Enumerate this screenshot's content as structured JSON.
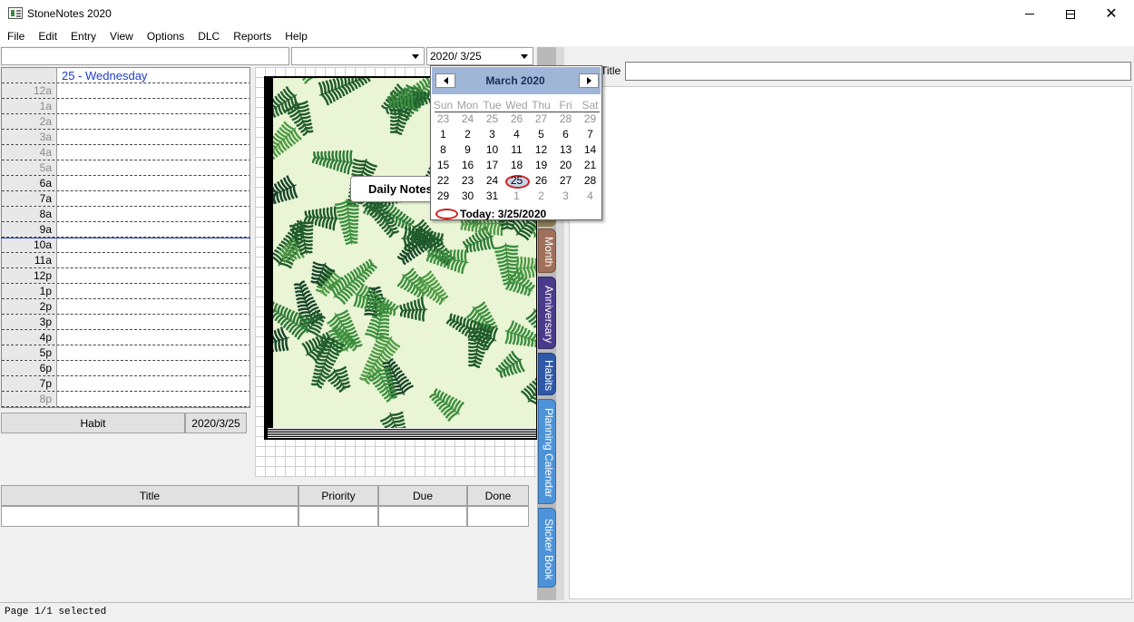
{
  "window": {
    "title": "StoneNotes 2020"
  },
  "menu": [
    "File",
    "Edit",
    "Entry",
    "View",
    "Options",
    "DLC",
    "Reports",
    "Help"
  ],
  "toolbar": {
    "search_value": "",
    "category_value": "",
    "date_value": "2020/  3/25"
  },
  "schedule": {
    "header": "25 - Wednesday",
    "rows": [
      {
        "time": "12a",
        "off": true
      },
      {
        "time": "1a",
        "off": true
      },
      {
        "time": "2a",
        "off": true
      },
      {
        "time": "3a",
        "off": true
      },
      {
        "time": "4a",
        "off": true
      },
      {
        "time": "5a",
        "off": true
      },
      {
        "time": "6a",
        "off": false
      },
      {
        "time": "7a",
        "off": false
      },
      {
        "time": "8a",
        "off": false
      },
      {
        "time": "9a",
        "off": false
      },
      {
        "time": "10a",
        "off": false
      },
      {
        "time": "11a",
        "off": false
      },
      {
        "time": "12p",
        "off": false
      },
      {
        "time": "1p",
        "off": false
      },
      {
        "time": "2p",
        "off": false
      },
      {
        "time": "3p",
        "off": false
      },
      {
        "time": "4p",
        "off": false
      },
      {
        "time": "5p",
        "off": false
      },
      {
        "time": "6p",
        "off": false
      },
      {
        "time": "7p",
        "off": false
      },
      {
        "time": "8p",
        "off": true
      }
    ],
    "current_line_color": "#1e3ccc"
  },
  "habit": {
    "label": "Habit",
    "date": "2020/3/25"
  },
  "tasks": {
    "columns": [
      "Title",
      "Priority",
      "Due",
      "Done"
    ]
  },
  "notebook": {
    "tab_label": "Daily Notes"
  },
  "side_tabs": [
    {
      "label": "Month",
      "color": "#a0705a"
    },
    {
      "label": "Anniversary",
      "color": "#4a3a8a"
    },
    {
      "label": "Habits",
      "color": "#2f58a8"
    },
    {
      "label": "Planning Calendar",
      "color": "#4d93d9"
    },
    {
      "label": "Sticker Book",
      "color": "#4d93d9"
    }
  ],
  "note": {
    "title_label": "Title",
    "title_value": ""
  },
  "status": {
    "text": "Page 1/1 selected"
  },
  "calendar": {
    "month_label": "March 2020",
    "weekdays": [
      "Sun",
      "Mon",
      "Tue",
      "Wed",
      "Thu",
      "Fri",
      "Sat"
    ],
    "weeks": [
      [
        [
          "23",
          1
        ],
        [
          "24",
          1
        ],
        [
          "25",
          1
        ],
        [
          "26",
          1
        ],
        [
          "27",
          1
        ],
        [
          "28",
          1
        ],
        [
          "29",
          1
        ]
      ],
      [
        [
          "1",
          0
        ],
        [
          "2",
          0
        ],
        [
          "3",
          0
        ],
        [
          "4",
          0
        ],
        [
          "5",
          0
        ],
        [
          "6",
          0
        ],
        [
          "7",
          0
        ]
      ],
      [
        [
          "8",
          0
        ],
        [
          "9",
          0
        ],
        [
          "10",
          0
        ],
        [
          "11",
          0
        ],
        [
          "12",
          0
        ],
        [
          "13",
          0
        ],
        [
          "14",
          0
        ]
      ],
      [
        [
          "15",
          0
        ],
        [
          "16",
          0
        ],
        [
          "17",
          0
        ],
        [
          "18",
          0
        ],
        [
          "19",
          0
        ],
        [
          "20",
          0
        ],
        [
          "21",
          0
        ]
      ],
      [
        [
          "22",
          0
        ],
        [
          "23",
          0
        ],
        [
          "24",
          0
        ],
        [
          "25",
          0
        ],
        [
          "26",
          0
        ],
        [
          "27",
          0
        ],
        [
          "28",
          0
        ]
      ],
      [
        [
          "29",
          0
        ],
        [
          "30",
          0
        ],
        [
          "31",
          0
        ],
        [
          "1",
          1
        ],
        [
          "2",
          1
        ],
        [
          "3",
          1
        ],
        [
          "4",
          1
        ]
      ]
    ],
    "selected": "25",
    "today_label": "Today: 3/25/2020",
    "header_color": "#9fb6d8"
  }
}
